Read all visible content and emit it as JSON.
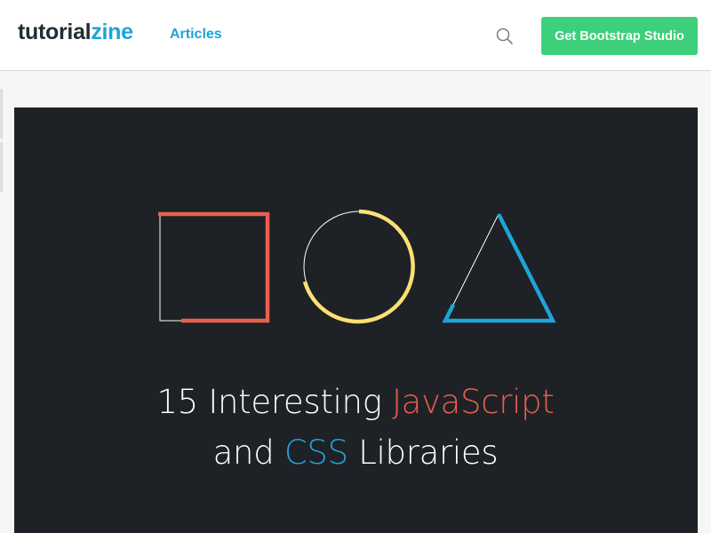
{
  "header": {
    "logo_part1": "tutorial",
    "logo_part2": "zine",
    "nav_articles": "Articles",
    "search_icon": "search-icon",
    "cta_label": "Get Bootstrap Studio"
  },
  "hero": {
    "title_line1_a": "15 Interesting ",
    "title_line1_b": "JavaScript",
    "title_line2_a": "and ",
    "title_line2_b": "CSS",
    "title_line2_c": " Libraries",
    "shapes": [
      "square-shape",
      "circle-shape",
      "triangle-shape"
    ]
  },
  "colors": {
    "brand_blue": "#1fa3d8",
    "cta_green": "#3ecf7a",
    "hero_bg": "#1e2125",
    "accent_red": "#e9604f",
    "accent_yellow": "#fbe072"
  }
}
